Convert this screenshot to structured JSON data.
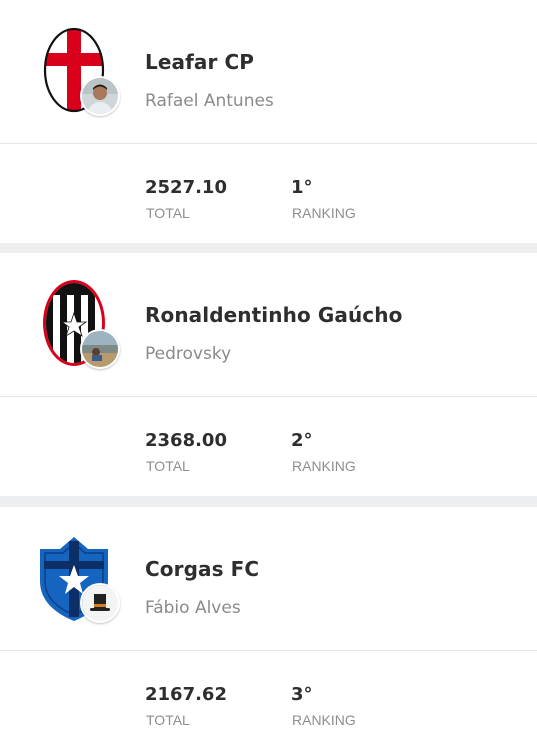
{
  "teams": [
    {
      "name": "Leafar CP",
      "owner": "Rafael Antunes",
      "total_value": "2527.10",
      "total_label": "TOTAL",
      "ranking_value": "1°",
      "ranking_label": "RANKING",
      "badge_icon": "red-cross-oval-crest-icon",
      "avatar_icon": "user-photo-avatar"
    },
    {
      "name": "Ronaldentinho Gaúcho",
      "owner": "Pedrovsky",
      "total_value": "2368.00",
      "total_label": "TOTAL",
      "ranking_value": "2°",
      "ranking_label": "RANKING",
      "badge_icon": "black-white-stripes-star-crest-icon",
      "avatar_icon": "landscape-photo-avatar"
    },
    {
      "name": "Corgas FC",
      "owner": "Fábio Alves",
      "total_value": "2167.62",
      "total_label": "TOTAL",
      "ranking_value": "3°",
      "ranking_label": "RANKING",
      "badge_icon": "blue-shield-star-crest-icon",
      "avatar_icon": "top-hat-avatar"
    }
  ],
  "colors": {
    "background": "#eceef0",
    "card": "#ffffff",
    "title_text": "#2e2e2e",
    "muted_text": "#8a8a8a",
    "crest_red": "#d9001b",
    "crest_blue": "#1565c0"
  }
}
